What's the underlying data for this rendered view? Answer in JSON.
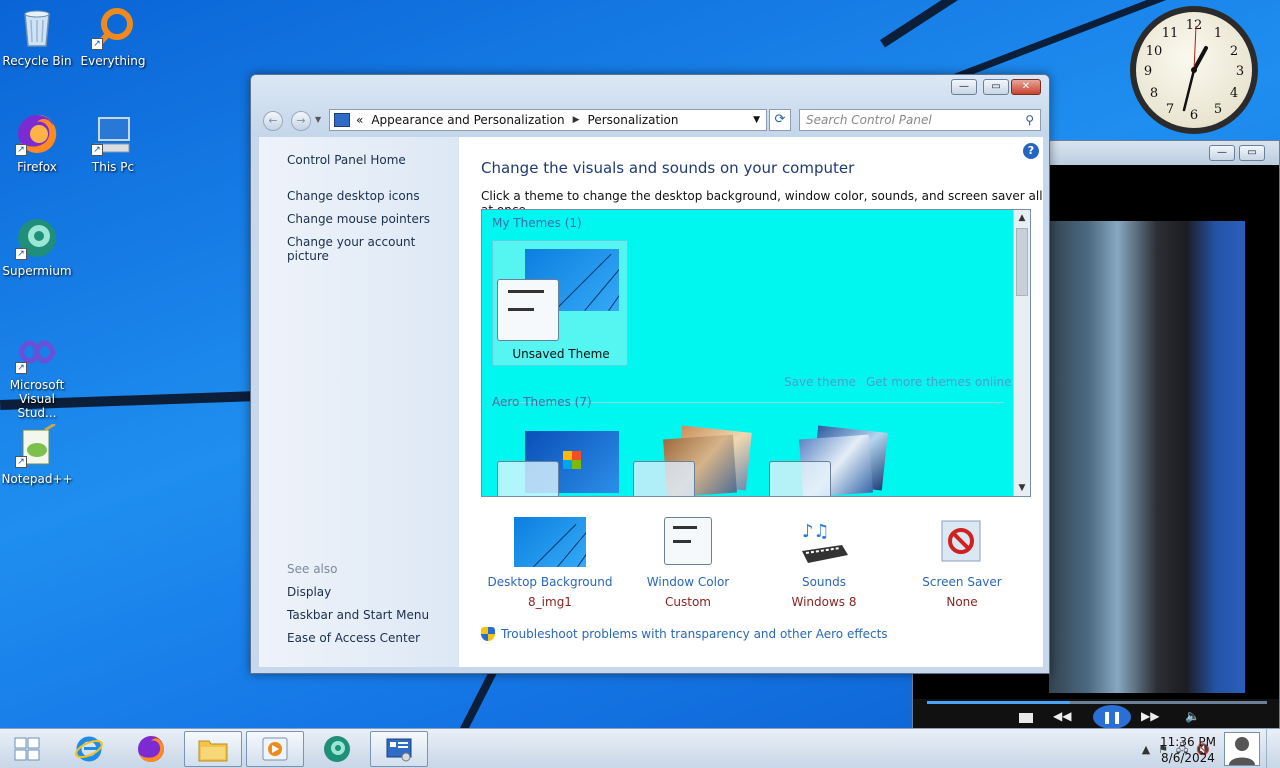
{
  "desktop": {
    "icons": [
      {
        "label": "Recycle Bin"
      },
      {
        "label": "Everything"
      },
      {
        "label": "Firefox"
      },
      {
        "label": "This Pc"
      },
      {
        "label": "Supermium"
      },
      {
        "label": "Microsoft Visual Stud..."
      },
      {
        "label": "Notepad++"
      }
    ]
  },
  "clock_gadget": {
    "numerals": [
      "12",
      "1",
      "2",
      "3",
      "4",
      "5",
      "6",
      "7",
      "8",
      "9",
      "10",
      "11"
    ]
  },
  "window": {
    "breadcrumb": {
      "prefix": "«",
      "parent": "Appearance and Personalization",
      "current": "Personalization"
    },
    "search_placeholder": "Search Control Panel",
    "sidebar": {
      "home": "Control Panel Home",
      "links": [
        "Change desktop icons",
        "Change mouse pointers",
        "Change your account picture"
      ],
      "see_also_heading": "See also",
      "see_also": [
        "Display",
        "Taskbar and Start Menu",
        "Ease of Access Center"
      ]
    },
    "main": {
      "heading": "Change the visuals and sounds on your computer",
      "description": "Click a theme to change the desktop background, window color, sounds, and screen saver all at once.",
      "my_themes_heading": "My Themes (1)",
      "unsaved_theme_label": "Unsaved Theme",
      "save_theme": "Save theme",
      "get_more_themes": "Get more themes online",
      "aero_themes_heading": "Aero Themes (7)",
      "options": [
        {
          "title": "Desktop Background",
          "value": "8_img1"
        },
        {
          "title": "Window Color",
          "value": "Custom"
        },
        {
          "title": "Sounds",
          "value": "Windows 8"
        },
        {
          "title": "Screen Saver",
          "value": "None"
        }
      ],
      "troubleshoot": "Troubleshoot problems with transparency and other Aero effects"
    }
  },
  "taskbar": {
    "time": "11:36 PM",
    "date": "8/6/2024"
  },
  "colors": {
    "theme_panel_bg": "#00f7f0",
    "link_blue": "#2968b8",
    "value_red": "#8b2323",
    "heading_blue": "#1e3a73"
  }
}
